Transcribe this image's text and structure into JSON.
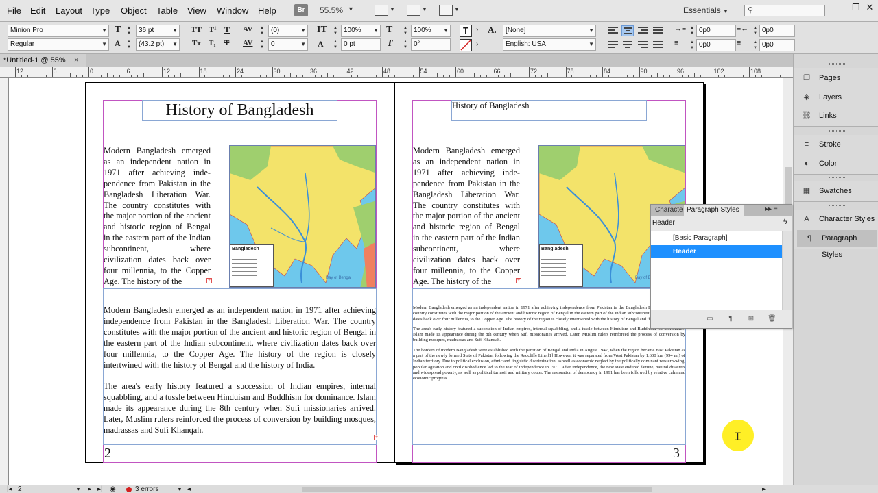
{
  "menu": [
    "File",
    "Edit",
    "Layout",
    "Type",
    "Object",
    "Table",
    "View",
    "Window",
    "Help"
  ],
  "toolbar": {
    "bridge_label": "Br",
    "zoom": "55.5%",
    "workspace": "Essentials",
    "search_placeholder": ""
  },
  "window_controls": {
    "minimize": "–",
    "restore": "❐",
    "close": "✕"
  },
  "control_panel": {
    "font_family": "Minion Pro",
    "font_style": "Regular",
    "font_size": "36 pt",
    "leading": "(43.2 pt)",
    "kerning": "(0)",
    "tracking": "0",
    "vertical_scale": "100%",
    "horizontal_scale": "100%",
    "baseline_shift": "0 pt",
    "skew": "0°",
    "char_style": "[None]",
    "language": "English: USA",
    "left_indent": "0p0",
    "right_indent": "0p0",
    "first_indent": "0p0",
    "last_indent": "0p0",
    "glyphs": {
      "all_caps": "TT",
      "superscript": "T¹",
      "underline": "T",
      "small_caps": "Tᴛ",
      "subscript": "T₁",
      "strike": "T"
    }
  },
  "document": {
    "tab_title": "*Untitled-1 @ 55%",
    "tab_close": "×"
  },
  "ruler": {
    "labels": [
      "12",
      "6",
      "0",
      "6",
      "12",
      "18",
      "24",
      "30",
      "36",
      "42",
      "48",
      "54",
      "60",
      "66",
      "72",
      "78",
      "84",
      "90",
      "96",
      "102",
      "108"
    ]
  },
  "page_left": {
    "heading": "History of Bangladesh",
    "col_text": "Modern Bangladesh emerged as an independent nation in 1971 after achieving inde-pendence from Pakistan in the Bangladesh Liberation War. The country constitutes with the major portion of the ancient and historic region of Bengal in the eastern part of the Indian subcontinent, where civilization dates back over four millennia, to the Copper Age. The history of the",
    "para1": "Modern Bangladesh emerged as an independent nation in 1971 after achieving independence from Pakistan in the Bangladesh Liberation War. The country constitutes with the major portion of the ancient and historic region of Bengal in the eastern part of the Indian subcontinent, where civilization dates back over four millennia, to the Copper Age. The history of the region is closely intertwined with the history of Bengal and the history of India.",
    "para2": "The area's early history featured a succession of Indian empires, internal squabbling, and a tussle between Hinduism and Buddhism for dominance. Islam made its appearance during the 8th century when Sufi missionaries arrived. Later, Muslim rulers reinforced the process of conversion by building mosques, madrassas and Sufi Khanqah.",
    "page_number": "2"
  },
  "page_right": {
    "heading": "History of Bangladesh",
    "col_text": "Modern Bangladesh emerged as an independent nation in 1971 after achieving inde-pendence from Pakistan in the Bangladesh Liberation War. The country constitutes with the major portion of the ancient and historic region of Bengal in the eastern part of the Indian subcontinent, where civilization dates back over four millennia, to the Copper Age. The history of the",
    "tiny1": "Modern Bangladesh emerged as an independent nation in 1971 after achieving independence from Pakistan in the Bangladesh Liberation War. The country constitutes with the major portion of the ancient and historic region of Bengal in the eastern part of the Indian subcontinent, where civilization dates back over four millennia, to the Copper Age. The history of the region is closely intertwined with the history of Bengal and the history of India.",
    "tiny2": "The area's early history featured a succession of Indian empires, internal squabbling, and a tussle between Hinduism and Buddhism for dominance. Islam made its appearance during the 8th century when Sufi missionaries arrived. Later, Muslim rulers reinforced the process of conversion by building mosques, madrassas and Sufi Khanqah.",
    "tiny3": "The borders of modern Bangladesh were established with the partition of Bengal and India in August 1947, when the region became East Pakistan as a part of the newly formed State of Pakistan following the Radcliffe Line.[1] However, it was separated from West Pakistan by 1,600 km (994 mi) of Indian territory. Due to political exclusion, ethnic and linguistic discrimination, as well as economic neglect by the politically dominant western-wing, popular agitation and civil disobedience led to the war of independence in 1971. After independence, the new state endured famine, natural disasters and widespread poverty, as well as political turmoil and military coups. The restoration of democracy in 1991 has been followed by relative calm and economic progress.",
    "page_number": "3"
  },
  "map": {
    "legend_title": "Bangladesh",
    "bay_label": "Bay of Bengal"
  },
  "paragraph_panel": {
    "tab_inactive": "Characte",
    "tab_active": "Paragraph Styles",
    "current_style": "Header",
    "styles": [
      {
        "label": "[Basic Paragraph]",
        "selected": false
      },
      {
        "label": "Header",
        "selected": true
      }
    ]
  },
  "dock": {
    "groups": [
      [
        "Pages",
        "Layers",
        "Links"
      ],
      [
        "Stroke",
        "Color"
      ],
      [
        "Swatches"
      ],
      [
        "Character Styles",
        "Paragraph Styles"
      ]
    ]
  },
  "statusbar": {
    "page": "2",
    "errors": "3 errors"
  },
  "colors": {
    "accent": "#1e90ff",
    "margin": "#c155c1",
    "frame": "#8aa7d4",
    "cursor_halo": "#ffec00",
    "error": "#d42020"
  }
}
